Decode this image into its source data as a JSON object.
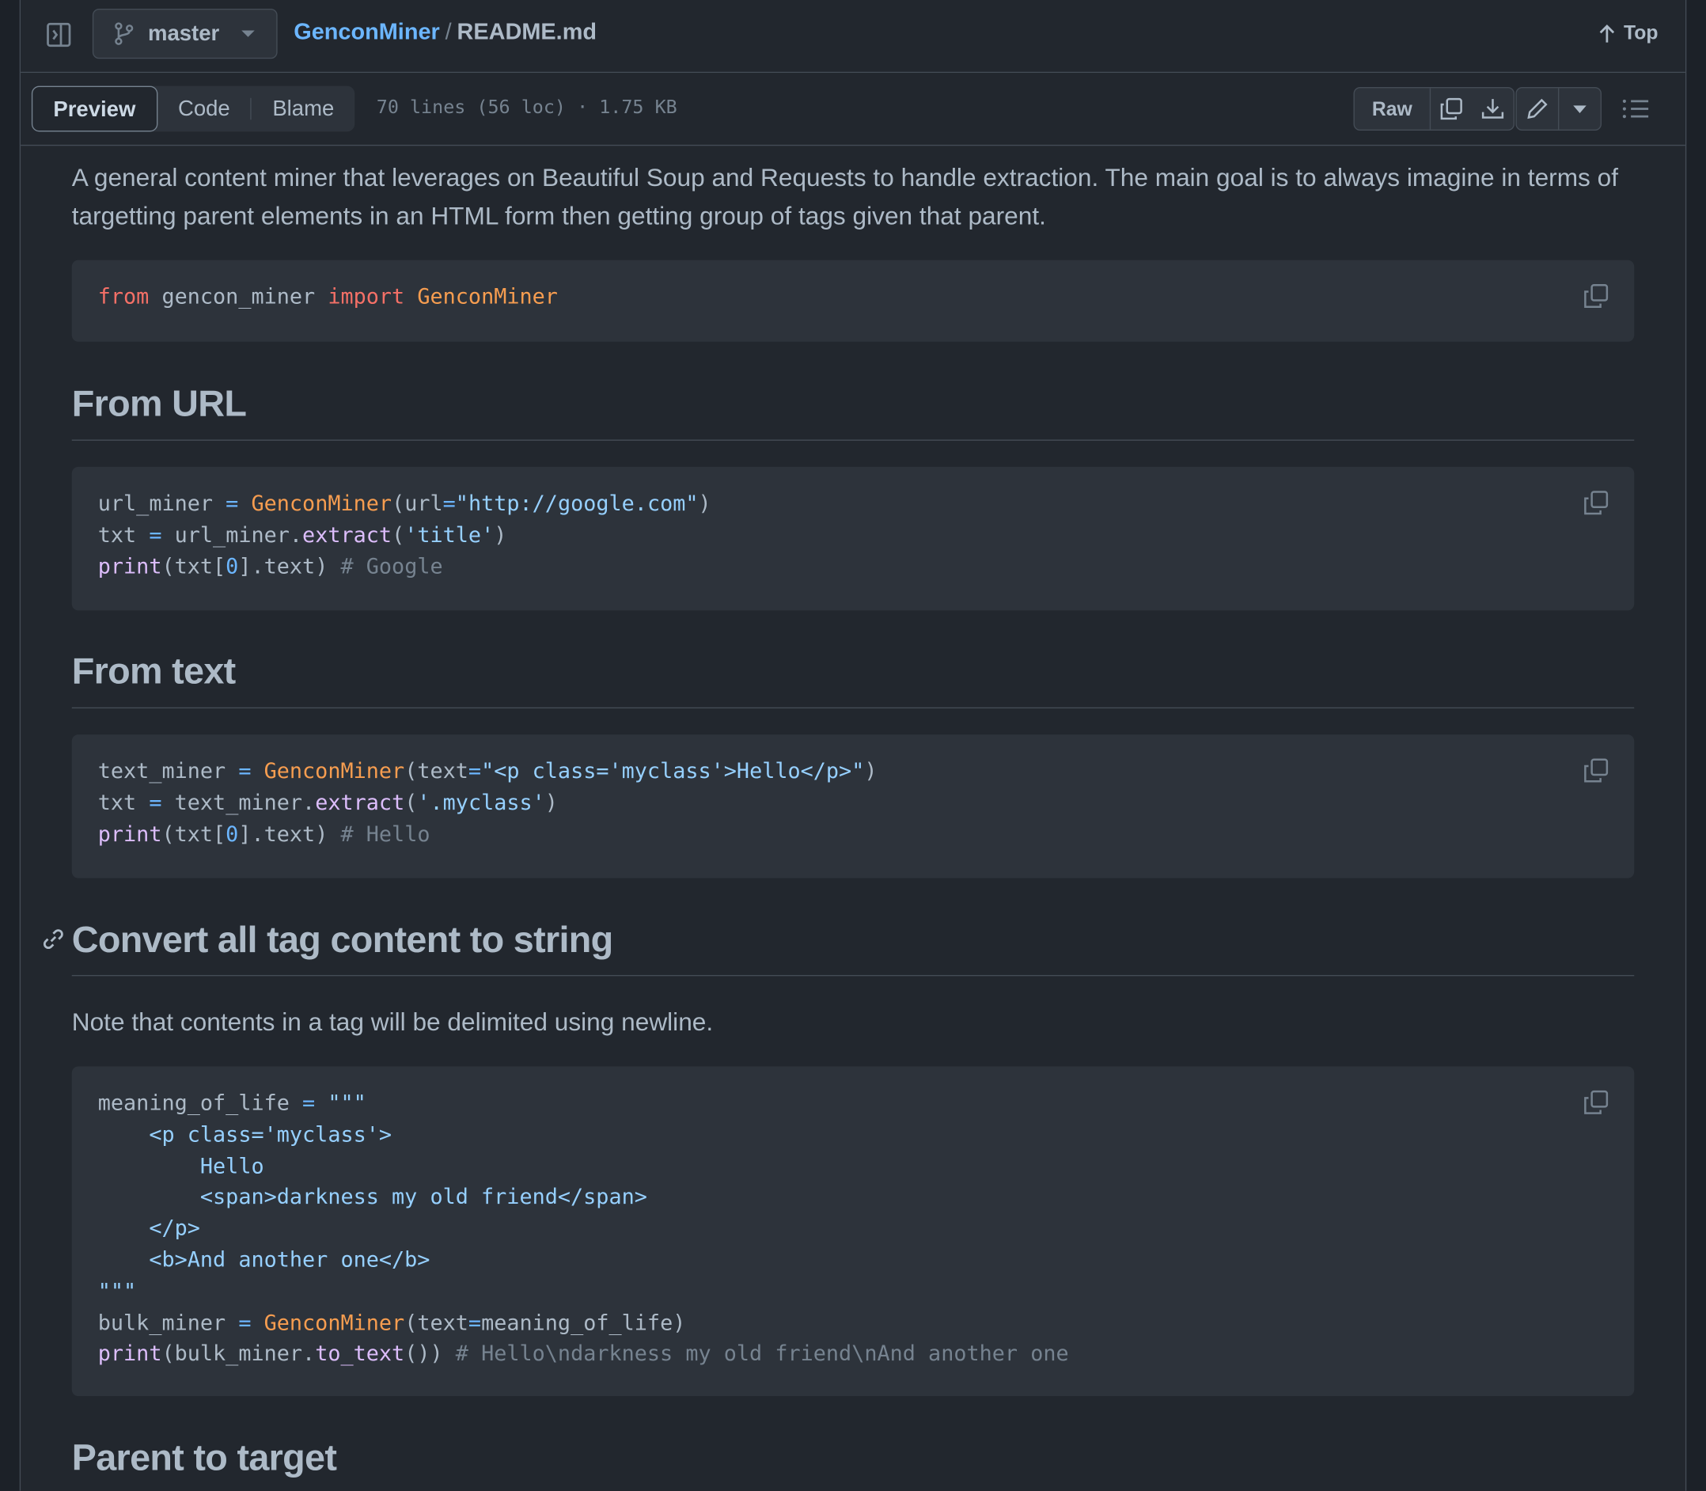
{
  "header": {
    "branch": "master",
    "repo": "GenconMiner",
    "separator": "/",
    "file": "README.md",
    "top_label": "Top"
  },
  "toolbar": {
    "tabs": [
      "Preview",
      "Code",
      "Blame"
    ],
    "file_meta": "70 lines (56 loc) · 1.75 KB",
    "raw_label": "Raw"
  },
  "content": {
    "intro": "A general content miner that leverages on Beautiful Soup and Requests to handle extraction. The main goal is to always imagine in terms of targetting parent elements in an HTML form then getting group of tags given that parent.",
    "code_import": {
      "from": "from",
      "module": " gencon_miner ",
      "import": "import",
      "cls": " GenconMiner"
    },
    "h_from_url": "From URL",
    "code_url": {
      "l1_var": "url_miner ",
      "l1_eq": "=",
      "l1_cls": " GenconMiner",
      "l1_open": "(url",
      "l1_eq2": "=",
      "l1_str": "\"http://google.com\"",
      "l1_close": ")",
      "l2_var": "txt ",
      "l2_eq": "=",
      "l2_mid": " url_miner.",
      "l2_fn": "extract",
      "l2_open": "(",
      "l2_str": "'title'",
      "l2_close": ")",
      "l3_fn": "print",
      "l3_a": "(txt[",
      "l3_num": "0",
      "l3_b": "].text) ",
      "l3_cm": "# Google"
    },
    "h_from_text": "From text",
    "code_text": {
      "l1_var": "text_miner ",
      "l1_eq": "=",
      "l1_cls": " GenconMiner",
      "l1_open": "(text",
      "l1_eq2": "=",
      "l1_str": "\"<p class='myclass'>Hello</p>\"",
      "l1_close": ")",
      "l2_var": "txt ",
      "l2_eq": "=",
      "l2_mid": " text_miner.",
      "l2_fn": "extract",
      "l2_open": "(",
      "l2_str": "'.myclass'",
      "l2_close": ")",
      "l3_fn": "print",
      "l3_a": "(txt[",
      "l3_num": "0",
      "l3_b": "].text) ",
      "l3_cm": "# Hello"
    },
    "h_convert": "Convert all tag content to string",
    "note": "Note that contents in a tag will be delimited using newline.",
    "code_bulk": {
      "l1_var": "meaning_of_life ",
      "l1_eq": "=",
      "l1_str": " \"\"\"",
      "l2": "    <p class='myclass'>",
      "l3": "        Hello",
      "l4": "        <span>darkness my old friend</span>",
      "l5": "    </p>",
      "l6": "    <b>And another one</b>",
      "l7": "\"\"\"",
      "l8_var": "bulk_miner ",
      "l8_eq": "=",
      "l8_cls": " GenconMiner",
      "l8_open": "(text",
      "l8_eq2": "=",
      "l8_rest": "meaning_of_life)",
      "l9_fn": "print",
      "l9_a": "(bulk_miner.",
      "l9_fn2": "to_text",
      "l9_b": "()) ",
      "l9_cm": "# Hello\\ndarkness my old friend\\nAnd another one"
    },
    "h_parent": "Parent to target"
  },
  "icons": {
    "panel": "sidebar-toggle-icon",
    "branch": "git-branch-icon",
    "arrow_up": "arrow-up-icon",
    "copy": "copy-icon",
    "download": "download-icon",
    "pencil": "pencil-icon",
    "caret": "triangle-down-icon",
    "list": "list-unordered-icon",
    "link": "link-icon"
  }
}
